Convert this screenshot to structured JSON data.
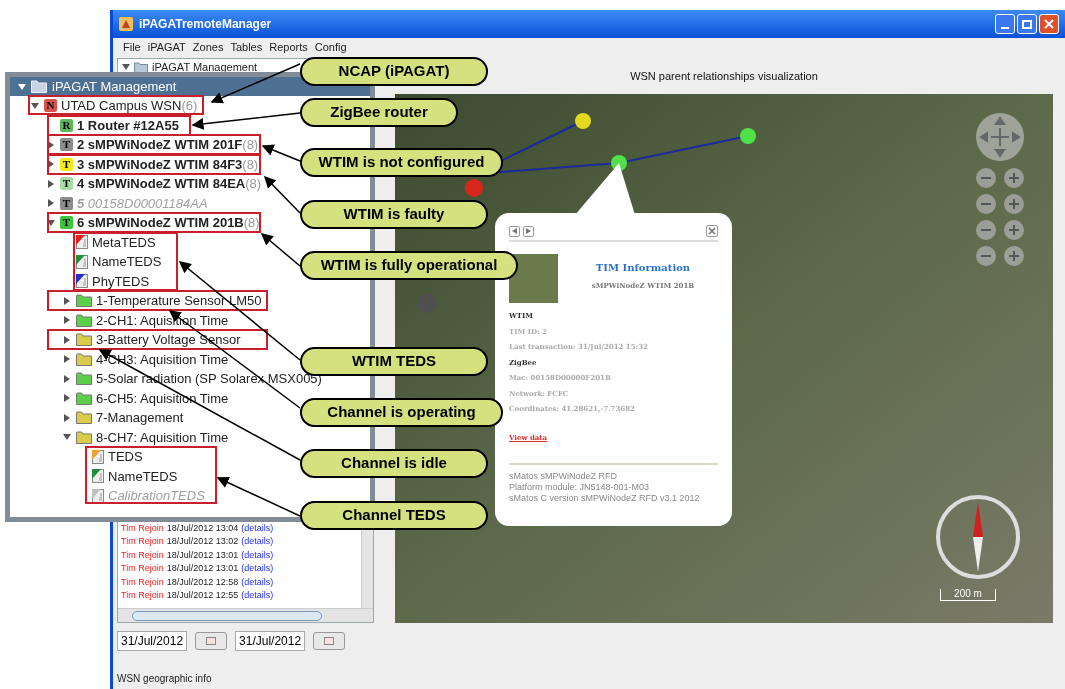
{
  "window": {
    "title": "iPAGATremoteManager"
  },
  "menu": [
    "File",
    "iPAGAT",
    "Zones",
    "Tables",
    "Reports",
    "Config"
  ],
  "side_tree": {
    "root": "iPAGAT Management",
    "expanded": true
  },
  "log": [
    {
      "event": "Tim Rejoin",
      "time": "18/Jul/2012 13:04",
      "link": "(details)"
    },
    {
      "event": "Tim Rejoin",
      "time": "18/Jul/2012 13:02",
      "link": "(details)"
    },
    {
      "event": "Tim Rejoin",
      "time": "18/Jul/2012 13:01",
      "link": "(details)"
    },
    {
      "event": "Tim Rejoin",
      "time": "18/Jul/2012 13:01",
      "link": "(details)"
    },
    {
      "event": "Tim Rejoin",
      "time": "18/Jul/2012 12:58",
      "link": "(details)"
    },
    {
      "event": "Tim Rejoin",
      "time": "18/Jul/2012 12:55",
      "link": "(details)"
    }
  ],
  "date_from": "31/Jul/2012",
  "date_to": "31/Jul/2012",
  "status_bar": "WSN geographic info",
  "map": {
    "title": "WSN parent relationships visualization",
    "scale": "200 m",
    "nodes": [
      {
        "color": "#d9261c"
      },
      {
        "color": "#e6d81e"
      },
      {
        "color": "#4fe04a"
      },
      {
        "color": "#4fe04a"
      },
      {
        "color": "#505050"
      }
    ]
  },
  "popup": {
    "title": "TIM Information",
    "subtitle": "sMPWiNodeZ WTIM 201B",
    "sections": [
      {
        "heading": "WTIM",
        "lines": [
          "TIM ID: 2",
          "Last transaction: 31/Jul/2012 15:32"
        ]
      },
      {
        "heading": "ZigBee",
        "lines": [
          "Mac: 00158D00000F201B",
          "Network: FCFC",
          "Coordinates: 41.28621,-7.73682"
        ]
      }
    ],
    "link": "View data",
    "footer": [
      "sMatos sMPWiNodeZ RFD",
      "Platform module: JN5148-001-M03",
      "sMatos C version sMPWiNodeZ RFD v3.1 2012"
    ]
  },
  "tree": {
    "title": "iPAGAT Management",
    "expanded": true,
    "items": [
      {
        "kind": "badge",
        "badge": "N",
        "color": "#d9534f",
        "label": "UTAD Campus WSN",
        "count": "(6)",
        "bold": false,
        "disabled": false,
        "expanded": true,
        "children": [
          {
            "kind": "badge",
            "badge": "R",
            "color": "#5cb85c",
            "index": "1",
            "label": "Router #12A55",
            "bold": true,
            "disabled": false
          },
          {
            "kind": "badge",
            "badge": "T",
            "color": "#8c8c8c",
            "index": "2",
            "label": "sMPWiNodeZ WTIM 201F",
            "count": "(8)",
            "bold": true,
            "disabled": false,
            "expanded": false
          },
          {
            "kind": "badge",
            "badge": "T",
            "color": "#f2ea1a",
            "index": "3",
            "label": "sMPWiNodeZ WTIM 84F3",
            "count": "(8)",
            "bold": true,
            "disabled": false,
            "expanded": false
          },
          {
            "kind": "badge",
            "badge": "T",
            "color": "#a8dba8",
            "index": "4",
            "label": "sMPWiNodeZ WTIM 84EA",
            "count": "(8)",
            "bold": true,
            "disabled": false,
            "expanded": false
          },
          {
            "kind": "badge",
            "badge": "T",
            "color": "#8c8c8c",
            "index": "5",
            "label": "00158D00001184AA",
            "bold": false,
            "disabled": true,
            "expanded": false
          },
          {
            "kind": "badge",
            "badge": "T",
            "color": "#3cc43c",
            "index": "6",
            "label": "sMPWiNodeZ WTIM 201B",
            "count": "(8)",
            "bold": true,
            "disabled": false,
            "expanded": true,
            "children": [
              {
                "kind": "teds",
                "color": "#e02020",
                "label": "MetaTEDS",
                "bold": false,
                "disabled": false
              },
              {
                "kind": "teds",
                "color": "#1f8f3f",
                "label": "NameTEDS",
                "bold": false,
                "disabled": false
              },
              {
                "kind": "teds",
                "color": "#2030d0",
                "label": "PhyTEDS",
                "bold": false,
                "disabled": false
              },
              {
                "kind": "channel",
                "color": "#5ccf4a",
                "label": "1-Temperature Sensor LM50",
                "bold": false,
                "disabled": false,
                "expanded": false
              },
              {
                "kind": "channel",
                "color": "#5ccf4a",
                "label": "2-CH1: Aquisition Time",
                "bold": false,
                "disabled": false,
                "expanded": false
              },
              {
                "kind": "channel",
                "color": "#d8cc4a",
                "label": "3-Battery Voltage Sensor",
                "bold": false,
                "disabled": false,
                "expanded": false
              },
              {
                "kind": "channel",
                "color": "#d8cc4a",
                "label": "4-CH3: Aquisition Time",
                "bold": false,
                "disabled": false,
                "expanded": false
              },
              {
                "kind": "channel",
                "color": "#5ccf4a",
                "label": "5-Solar radiation (SP Solarex MSX005)",
                "bold": false,
                "disabled": false,
                "expanded": false
              },
              {
                "kind": "channel",
                "color": "#5ccf4a",
                "label": "6-CH5: Aquisition Time",
                "bold": false,
                "disabled": false,
                "expanded": false
              },
              {
                "kind": "channel",
                "color": "#d8cc4a",
                "label": "7-Management",
                "bold": false,
                "disabled": false,
                "expanded": false
              },
              {
                "kind": "channel",
                "color": "#d8cc4a",
                "label": "8-CH7: Aquisition Time",
                "bold": false,
                "disabled": false,
                "expanded": true,
                "children": [
                  {
                    "kind": "teds",
                    "color": "#f0a030",
                    "label": "TEDS",
                    "bold": false,
                    "disabled": false
                  },
                  {
                    "kind": "teds",
                    "color": "#1f8f3f",
                    "label": "NameTEDS",
                    "bold": false,
                    "disabled": false
                  },
                  {
                    "kind": "teds",
                    "color": "#c0c0c0",
                    "label": "CalibrationTEDS",
                    "bold": false,
                    "disabled": true
                  }
                ]
              }
            ]
          }
        ]
      }
    ]
  },
  "callouts": [
    "NCAP (iPAGAT)",
    "ZigBee router",
    "WTIM is not configured",
    "WTIM is faulty",
    "WTIM is fully operational",
    "WTIM TEDS",
    "Channel is operating",
    "Channel is idle",
    "Channel TEDS"
  ]
}
